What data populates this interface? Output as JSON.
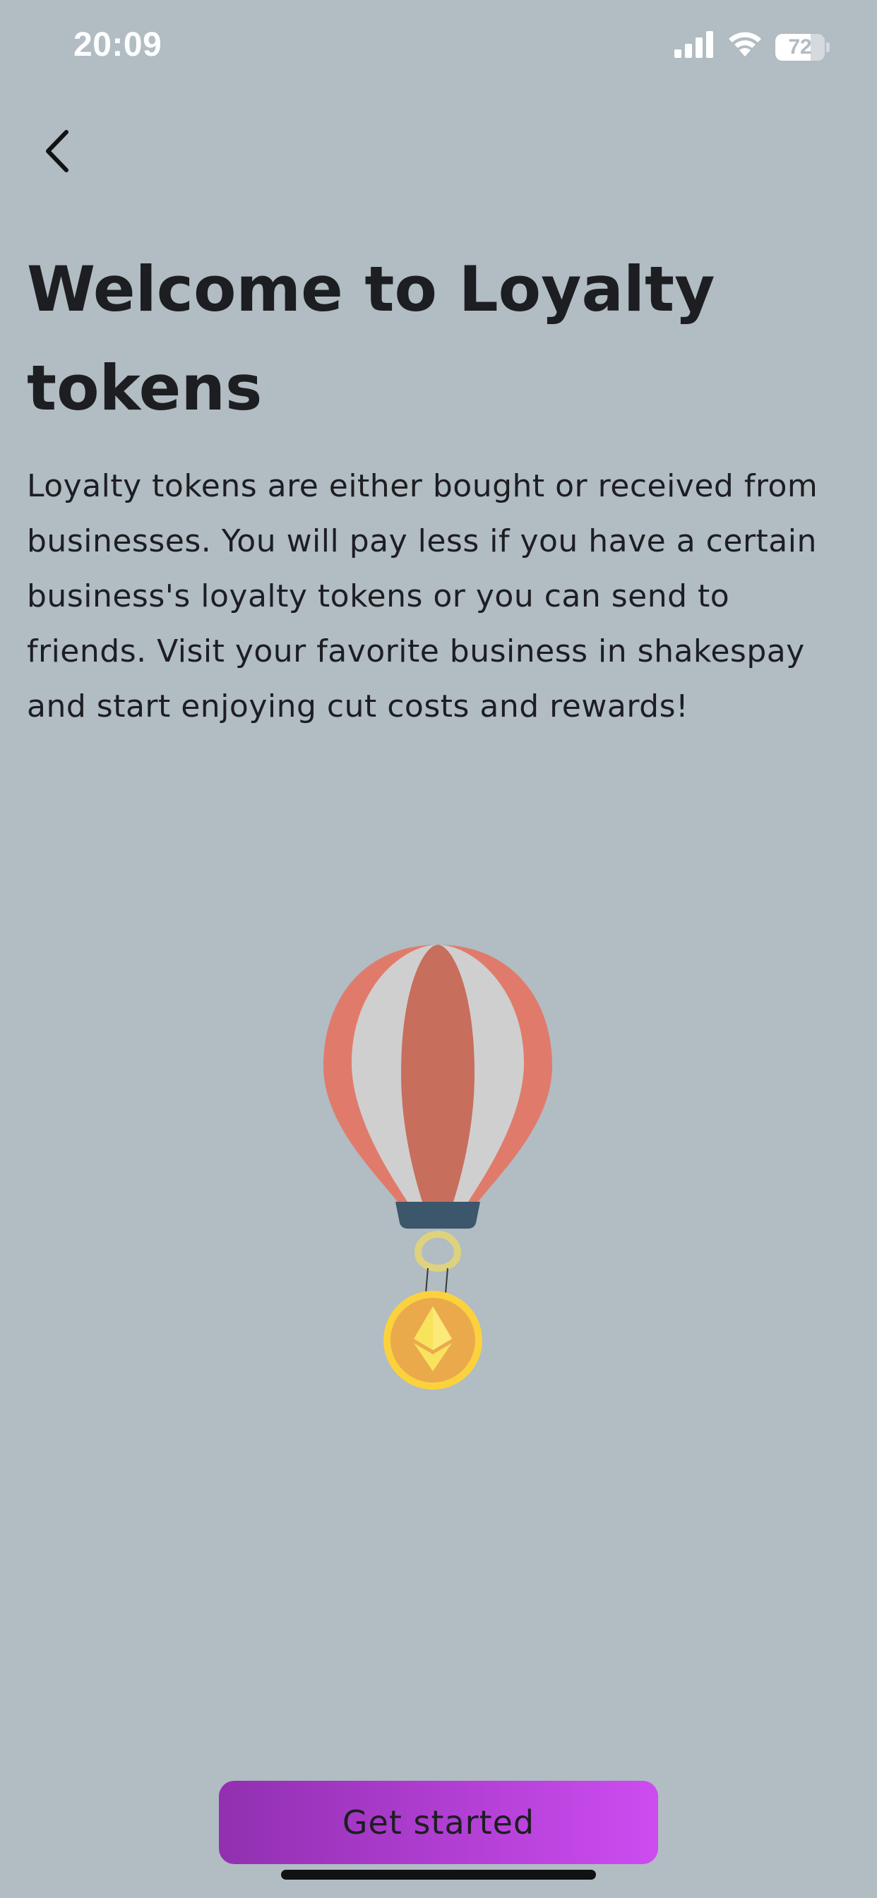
{
  "status_bar": {
    "time": "20:09",
    "battery_percent": "72",
    "battery_level": 0.72
  },
  "header": {
    "back_icon": "chevron-left-icon"
  },
  "main": {
    "title": "Welcome to Loyalty tokens",
    "description": "Loyalty tokens are either bought or received from businesses. You will pay less if you have a certain business's loyalty tokens or you can send to friends. Visit your favorite business in shakespay and start enjoying cut costs and rewards!",
    "illustration": "hot-air-balloon-with-ethereum-coin"
  },
  "footer": {
    "get_started_label": "Get started"
  },
  "colors": {
    "background": "#b1bcc3",
    "text": "#1d1e22",
    "button_gradient_start": "#9130b0",
    "button_gradient_end": "#cc4cf0"
  }
}
